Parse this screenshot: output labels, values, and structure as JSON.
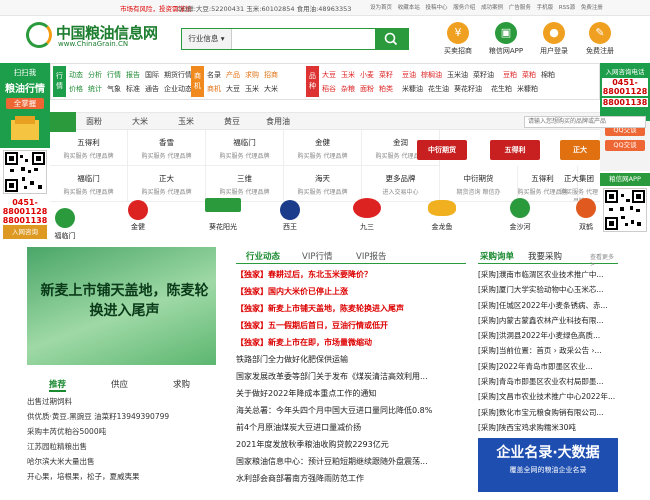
{
  "topbar": {
    "warning": "市场有风险，投资需谨慎",
    "contact": "QQ群:大豆:52200431   玉米:60102854   食用油:48963353",
    "links": [
      "设为首页",
      "收藏本站",
      "投稿中心",
      "服务介绍",
      "成功案例",
      "广告服务",
      "手机版",
      "RSS源",
      "免费注册"
    ]
  },
  "header": {
    "logo_name": "中国粮油信息网",
    "logo_url": "www.ChinaGrain.CN",
    "search_category": "行业信息",
    "search_placeholder": "",
    "icons": [
      {
        "label": "买卖招商",
        "color": "#f0a020",
        "glyph": "¥"
      },
      {
        "label": "粮信网APP",
        "color": "#2a9a3c",
        "glyph": "▣"
      },
      {
        "label": "用户登录",
        "color": "#f0a020",
        "glyph": "●"
      },
      {
        "label": "免费注册",
        "color": "#f0a020",
        "glyph": "✎"
      }
    ]
  },
  "left_sidebar": {
    "ad_line1": "扫扫我",
    "ad_line2": "粮油行情",
    "ad_line3": "全掌握",
    "tel": "0451-88001128 88001138",
    "join": "入网咨询"
  },
  "right_sidebar": {
    "ad_title": "入网咨询电话",
    "ad_tel1": "0451-88001128",
    "ad_tel2": "88001138",
    "qq1": "QQ交谈",
    "qq2": "QQ交谈",
    "app": "粮信网APP"
  },
  "nav": {
    "news_tag": "行情",
    "news_items": [
      "动态",
      "分析",
      "行情",
      "报告",
      "国际",
      "期货行情",
      "价格",
      "统计",
      "气象",
      "标准",
      "通告",
      "企业动态"
    ],
    "biz_tag": "商机",
    "biz_items": [
      "名录",
      "产品",
      "求购",
      "招商",
      "商机",
      "大豆",
      "玉米",
      "大米"
    ],
    "product_tag": "品种",
    "product_items": [
      "大豆",
      "玉米",
      "小麦",
      "菜籽",
      "稻谷",
      "杂粮",
      "面粉",
      "粕类",
      "豆油",
      "棕榈油",
      "玉米油",
      "菜籽油",
      "米糠油",
      "花生油",
      "葵花籽油",
      "豆粕",
      "菜粕",
      "棉粕",
      "花生粕",
      "米糠粕"
    ]
  },
  "cattabs": {
    "items": [
      "面粉",
      "大米",
      "玉米",
      "黄豆",
      "食用油"
    ],
    "search_placeholder": "请输入您想购买的品牌或产品"
  },
  "brands_row1": [
    {
      "name": "五得利",
      "sub": "购买服务 代理品牌"
    },
    {
      "name": "香雪",
      "sub": "购买服务 代理品牌"
    },
    {
      "name": "福临门",
      "sub": "购买服务 代理品牌"
    },
    {
      "name": "金健",
      "sub": "购买服务 代理品牌"
    },
    {
      "name": "金润",
      "sub": "购买服务 代理品牌"
    }
  ],
  "brands_row2": [
    {
      "name": "福临门",
      "sub": "购买服务 代理品牌"
    },
    {
      "name": "正大",
      "sub": "购买服务 代理品牌"
    },
    {
      "name": "三维",
      "sub": "购买服务 代理品牌"
    },
    {
      "name": "海天",
      "sub": "购买服务 代理品牌"
    },
    {
      "name": "更多品牌",
      "sub": "进入交易中心"
    }
  ],
  "brand_logos": [
    {
      "name": "中衍期货",
      "color": "#c82020"
    },
    {
      "name": "五得利",
      "color": "#c82020"
    },
    {
      "name": "正大",
      "color": "#e07010"
    }
  ],
  "brands_row2_right": [
    {
      "name": "中衍期货",
      "sub": "期货咨询 粮信办"
    },
    {
      "name": "五得利",
      "sub": "购买服务 代理品牌"
    },
    {
      "name": "正大集团",
      "sub": "购买服务 代理品牌"
    }
  ],
  "brands_row3": [
    "福临门",
    "金健",
    "葵花阳光",
    "西王",
    "九三",
    "金龙鱼",
    "金沙河",
    "双鹤"
  ],
  "banner": {
    "text": "新麦上市铺天盖地，陈麦轮换进入尾声"
  },
  "left_list": {
    "tabs": [
      "推荐",
      "供应",
      "求购"
    ],
    "items": [
      "出售过期饲料",
      "供优质·黄豆.黑豌豆 油菜籽13949390799",
      "采购丰芮优粕谷5000吨",
      "江苏园粒精粮出售",
      "哈尔滨大米大量出售",
      "开心果，培根果，松子，夏威夷果"
    ]
  },
  "mid_news": {
    "tabs": [
      "行业动态",
      "VIP行情",
      "VIP报告"
    ],
    "items": [
      {
        "text": "【独家】春耕过后，东北玉米要降价？",
        "hot": true
      },
      {
        "text": "【独家】国内大米价已停止上涨",
        "hot": true
      },
      {
        "text": "【独家】新麦上市铺天盖地，陈麦轮换进入尾声",
        "hot": true
      },
      {
        "text": "【独家】五一假期后首日，豆油行情或低开",
        "hot": true
      },
      {
        "text": "【独家】新麦上市在即，市场量微缩动",
        "hot": true
      },
      {
        "text": "铁路部门全力做好化肥保供运输",
        "hot": false
      },
      {
        "text": "国家发展改革委等部门关于发布《煤炭清洁高效利用...",
        "hot": false
      },
      {
        "text": "关于做好2022年降成本重点工作的通知",
        "hot": false
      },
      {
        "text": "海关总署：今年头四个月中国大豆进口量同比降低0.8%",
        "hot": false
      },
      {
        "text": "前4个月原油煤炭大豆进口量减价扬",
        "hot": false
      },
      {
        "text": "2021年度发放秋季粮油收购贷款2293亿元",
        "hot": false
      },
      {
        "text": "国家粮油信息中心：预计豆粕短期继续跟随外盘震荡...",
        "hot": false
      },
      {
        "text": "水利部会商部署南方强降雨防范工作",
        "hot": false
      }
    ]
  },
  "right_list": {
    "tabs": [
      "采购询单",
      "我要采购"
    ],
    "more": "查看更多 >",
    "items": [
      "[采购]濮南市临渭区农业技术推广中...",
      "[采购]厦门大学实验动物中心玉米芯...",
      "[采购]任城区2022年小麦条锈病、赤...",
      "[采购]内蒙古蒙鑫农林产业科技有限...",
      "[采购]洪洞县2022年小麦绿色高质...",
      "[采购]当前位置：首页 › 政采公告 ›...",
      "[采购]2022年青岛市即墨区农业...",
      "[采购]青岛市即墨区农业农村局即墨...",
      "[采购]文昌市农业技术推广中心2022年...",
      "[采购]数化市宝元粮食购销有限公司...",
      "[采购]陕西宝鸡求购糯米30吨"
    ]
  },
  "adbox": {
    "title": "企业名录·大数据",
    "sub": "覆盖全网的粮油企业名录"
  },
  "colors": {
    "brand_green": "#2a9a3c",
    "alert_red": "#d00000",
    "accent_orange": "#f08a1e"
  }
}
